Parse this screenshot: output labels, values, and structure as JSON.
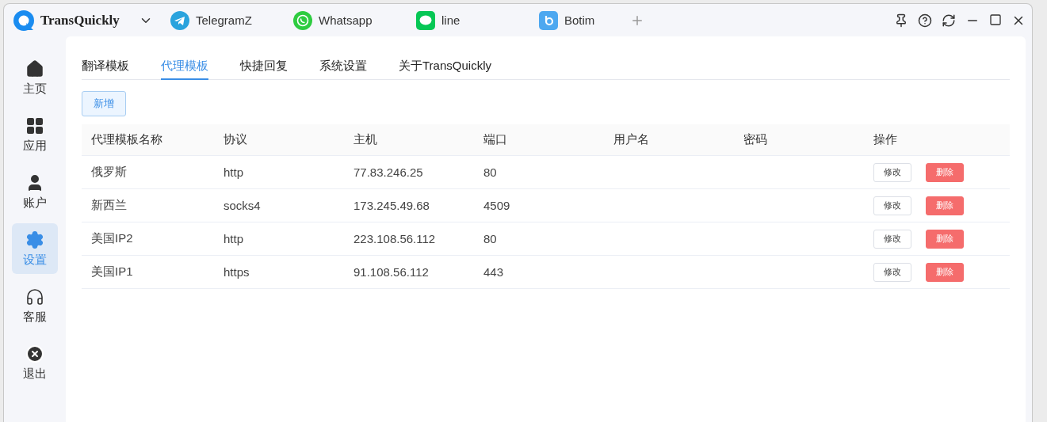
{
  "app": {
    "name": "TransQuickly"
  },
  "app_tabs": [
    {
      "kind": "telegram",
      "label": "TelegramZ"
    },
    {
      "kind": "whatsapp",
      "label": "Whatsapp"
    },
    {
      "kind": "line",
      "label": "line"
    },
    {
      "kind": "botim",
      "label": "Botim"
    }
  ],
  "sidebar": {
    "items": [
      {
        "kind": "home",
        "label": "主页",
        "selected": false
      },
      {
        "kind": "apps",
        "label": "应用",
        "selected": false
      },
      {
        "kind": "account",
        "label": "账户",
        "selected": false
      },
      {
        "kind": "settings",
        "label": "设置",
        "selected": true
      },
      {
        "kind": "support",
        "label": "客服",
        "selected": false
      },
      {
        "kind": "logout",
        "label": "退出",
        "selected": false
      }
    ]
  },
  "tabs": [
    {
      "label": "翻译模板",
      "selected": false
    },
    {
      "label": "代理模板",
      "selected": true
    },
    {
      "label": "快捷回复",
      "selected": false
    },
    {
      "label": "系统设置",
      "selected": false
    },
    {
      "label": "关于TransQuickly",
      "selected": false
    }
  ],
  "add_button": "新增",
  "table": {
    "columns": [
      "代理模板名称",
      "协议",
      "主机",
      "端口",
      "用户名",
      "密码",
      "操作"
    ],
    "rows": [
      {
        "name": "俄罗斯",
        "protocol": "http",
        "host": "77.83.246.25",
        "port": "80",
        "edit": "修改",
        "delete": "删除"
      },
      {
        "name": "新西兰",
        "protocol": "socks4",
        "host": "173.245.49.68",
        "port": "4509",
        "edit": "修改",
        "delete": "删除"
      },
      {
        "name": "美国IP2",
        "protocol": "http",
        "host": "223.108.56.112",
        "port": "80",
        "edit": "修改",
        "delete": "删除"
      },
      {
        "name": "美国IP1",
        "protocol": "https",
        "host": "91.108.56.112",
        "port": "443",
        "edit": "修改",
        "delete": "删除"
      }
    ]
  }
}
